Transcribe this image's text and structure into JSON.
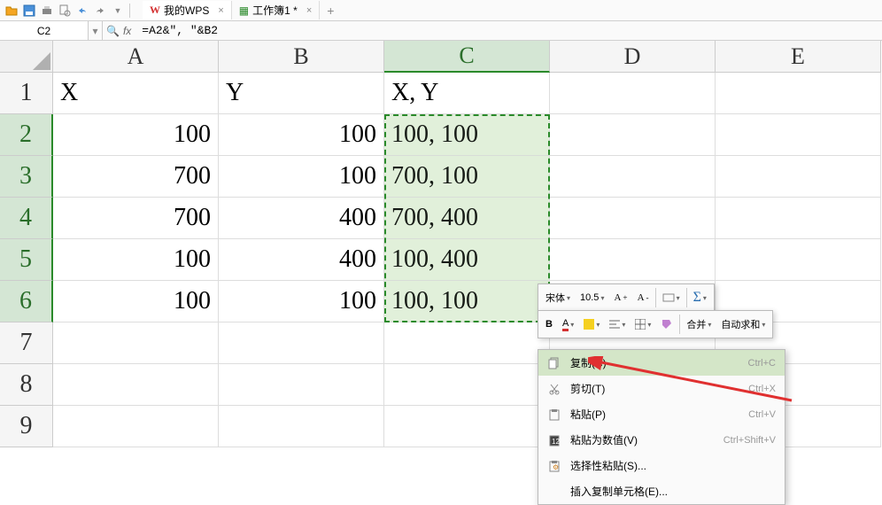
{
  "tabs": [
    {
      "label": "我的WPS",
      "icon": "W",
      "iconColor": "#d32f2f"
    },
    {
      "label": "工作簿1 *",
      "icon": "▦",
      "iconColor": "#2a8a2a"
    }
  ],
  "nameBox": "C2",
  "formula": "=A2&\", \"&B2",
  "columns": [
    "A",
    "B",
    "C",
    "D",
    "E"
  ],
  "rows": [
    {
      "n": "1",
      "cells": [
        "X",
        "Y",
        "X, Y",
        "",
        ""
      ],
      "align": [
        "left",
        "left",
        "left",
        "left",
        "left"
      ]
    },
    {
      "n": "2",
      "cells": [
        "100",
        "100",
        "100, 100",
        "",
        ""
      ],
      "align": [
        "right",
        "right",
        "left",
        "left",
        "left"
      ]
    },
    {
      "n": "3",
      "cells": [
        "700",
        "100",
        "700, 100",
        "",
        ""
      ],
      "align": [
        "right",
        "right",
        "left",
        "left",
        "left"
      ]
    },
    {
      "n": "4",
      "cells": [
        "700",
        "400",
        "700, 400",
        "",
        ""
      ],
      "align": [
        "right",
        "right",
        "left",
        "left",
        "left"
      ]
    },
    {
      "n": "5",
      "cells": [
        "100",
        "400",
        "100, 400",
        "",
        ""
      ],
      "align": [
        "right",
        "right",
        "left",
        "left",
        "left"
      ]
    },
    {
      "n": "6",
      "cells": [
        "100",
        "100",
        "100, 100",
        "",
        ""
      ],
      "align": [
        "right",
        "right",
        "left",
        "left",
        "left"
      ]
    },
    {
      "n": "7",
      "cells": [
        "",
        "",
        "",
        "",
        ""
      ],
      "align": [
        "left",
        "left",
        "left",
        "left",
        "left"
      ]
    },
    {
      "n": "8",
      "cells": [
        "",
        "",
        "",
        "",
        ""
      ],
      "align": [
        "left",
        "left",
        "left",
        "left",
        "left"
      ]
    },
    {
      "n": "9",
      "cells": [
        "",
        "",
        "",
        "",
        ""
      ],
      "align": [
        "left",
        "left",
        "left",
        "left",
        "left"
      ]
    }
  ],
  "miniToolbar": {
    "font": "宋体",
    "size": "10.5",
    "mergeLabel": "合并",
    "sumLabel": "自动求和"
  },
  "contextMenu": [
    {
      "icon": "copy",
      "label": "复制(C)",
      "shortcut": "Ctrl+C",
      "hover": true
    },
    {
      "icon": "cut",
      "label": "剪切(T)",
      "shortcut": "Ctrl+X"
    },
    {
      "icon": "paste",
      "label": "粘贴(P)",
      "shortcut": "Ctrl+V"
    },
    {
      "icon": "paste-val",
      "label": "粘贴为数值(V)",
      "shortcut": "Ctrl+Shift+V"
    },
    {
      "icon": "paste-special",
      "label": "选择性粘贴(S)...",
      "shortcut": ""
    },
    {
      "icon": "",
      "label": "插入复制单元格(E)...",
      "shortcut": ""
    }
  ]
}
